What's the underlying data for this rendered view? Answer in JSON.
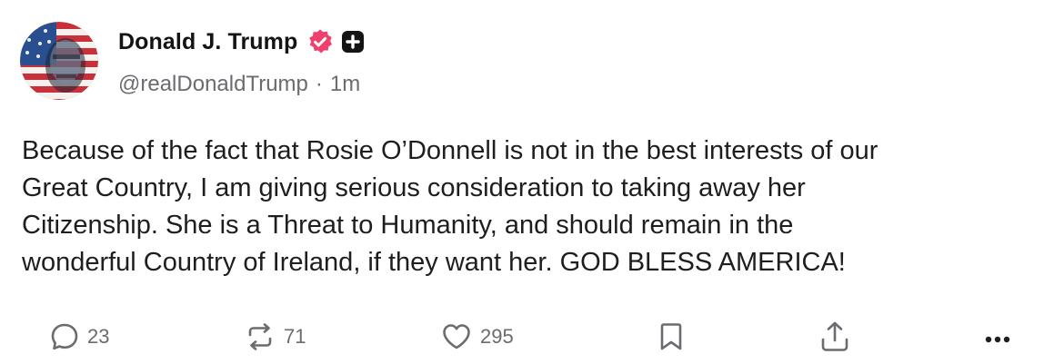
{
  "author": {
    "name": "Donald J. Trump",
    "handle": "@realDonaldTrump",
    "separator": "·",
    "time": "1m"
  },
  "badges": {
    "verified_icon": "verified-badge-icon",
    "verified_color": "#f0406d",
    "plus_icon": "plus-square-icon"
  },
  "post": {
    "text": "Because of the fact that Rosie O’Donnell is not in the best interests of our\nGreat Country, I am giving serious consideration to taking away her\nCitizenship. She is a Threat to Humanity, and should remain in the\nwonderful Country of Ireland, if they want her. GOD BLESS AMERICA!"
  },
  "actions": {
    "reply": {
      "icon": "reply-bubble-icon",
      "count": "23"
    },
    "retruth": {
      "icon": "retruth-arrows-icon",
      "count": "71"
    },
    "like": {
      "icon": "heart-icon",
      "count": "295"
    },
    "bookmark": {
      "icon": "bookmark-icon"
    },
    "share": {
      "icon": "share-upload-icon"
    },
    "more": {
      "icon": "more-dots-icon"
    }
  },
  "colors": {
    "text": "#1e1e1e",
    "muted": "#6b6b70",
    "verified": "#f0406d"
  }
}
